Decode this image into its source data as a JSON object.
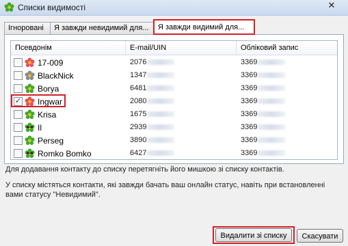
{
  "window": {
    "title": "Списки видимості",
    "close_glyph": "✕"
  },
  "tabs": [
    {
      "label": "Ігноровані"
    },
    {
      "label": "Я завжди невидимий для..."
    },
    {
      "label": "Я завжди видимий для..."
    }
  ],
  "list": {
    "columns": [
      "Псевдонім",
      "E-mail/UIN",
      "Обліковий запис"
    ],
    "rows": [
      {
        "nick": "17-009",
        "uin": "2076",
        "account": "3369",
        "checked": false,
        "status": "flower-red"
      },
      {
        "nick": "BlackNick",
        "uin": "1347",
        "account": "3369",
        "checked": false,
        "status": "flower-grey"
      },
      {
        "nick": "Borya",
        "uin": "6481",
        "account": "3369",
        "checked": false,
        "status": "flower-green"
      },
      {
        "nick": "Ingwar",
        "uin": "2080",
        "account": "3369",
        "checked": true,
        "status": "flower-red"
      },
      {
        "nick": "Krisa",
        "uin": "1675",
        "account": "3369",
        "checked": false,
        "status": "flower-green"
      },
      {
        "nick": "Il",
        "uin": "2939",
        "account": "3369",
        "checked": false,
        "status": "flower-glasses"
      },
      {
        "nick": "Perseg",
        "uin": "3890",
        "account": "3369",
        "checked": false,
        "status": "flower-green"
      },
      {
        "nick": "Romko Bomko",
        "uin": "6427",
        "account": "3369",
        "checked": false,
        "status": "flower-glasses"
      }
    ]
  },
  "info": {
    "line1": "Для додавання контакту до списку перетягніть його мишкою зі списку контактів.",
    "line2": "У списку містяться контакти, які завжди бачать ваш онлайн статус, навіть при встановленні",
    "line3": "вами статусу \"Невидимий\"."
  },
  "buttons": {
    "remove": "Видалити зі списку",
    "cancel": "Скасувати"
  },
  "colors": {
    "highlight": "#d0202a",
    "flower_red": "#e8505a",
    "flower_green": "#3faa2e",
    "flower_grey": "#8a8a8a"
  }
}
